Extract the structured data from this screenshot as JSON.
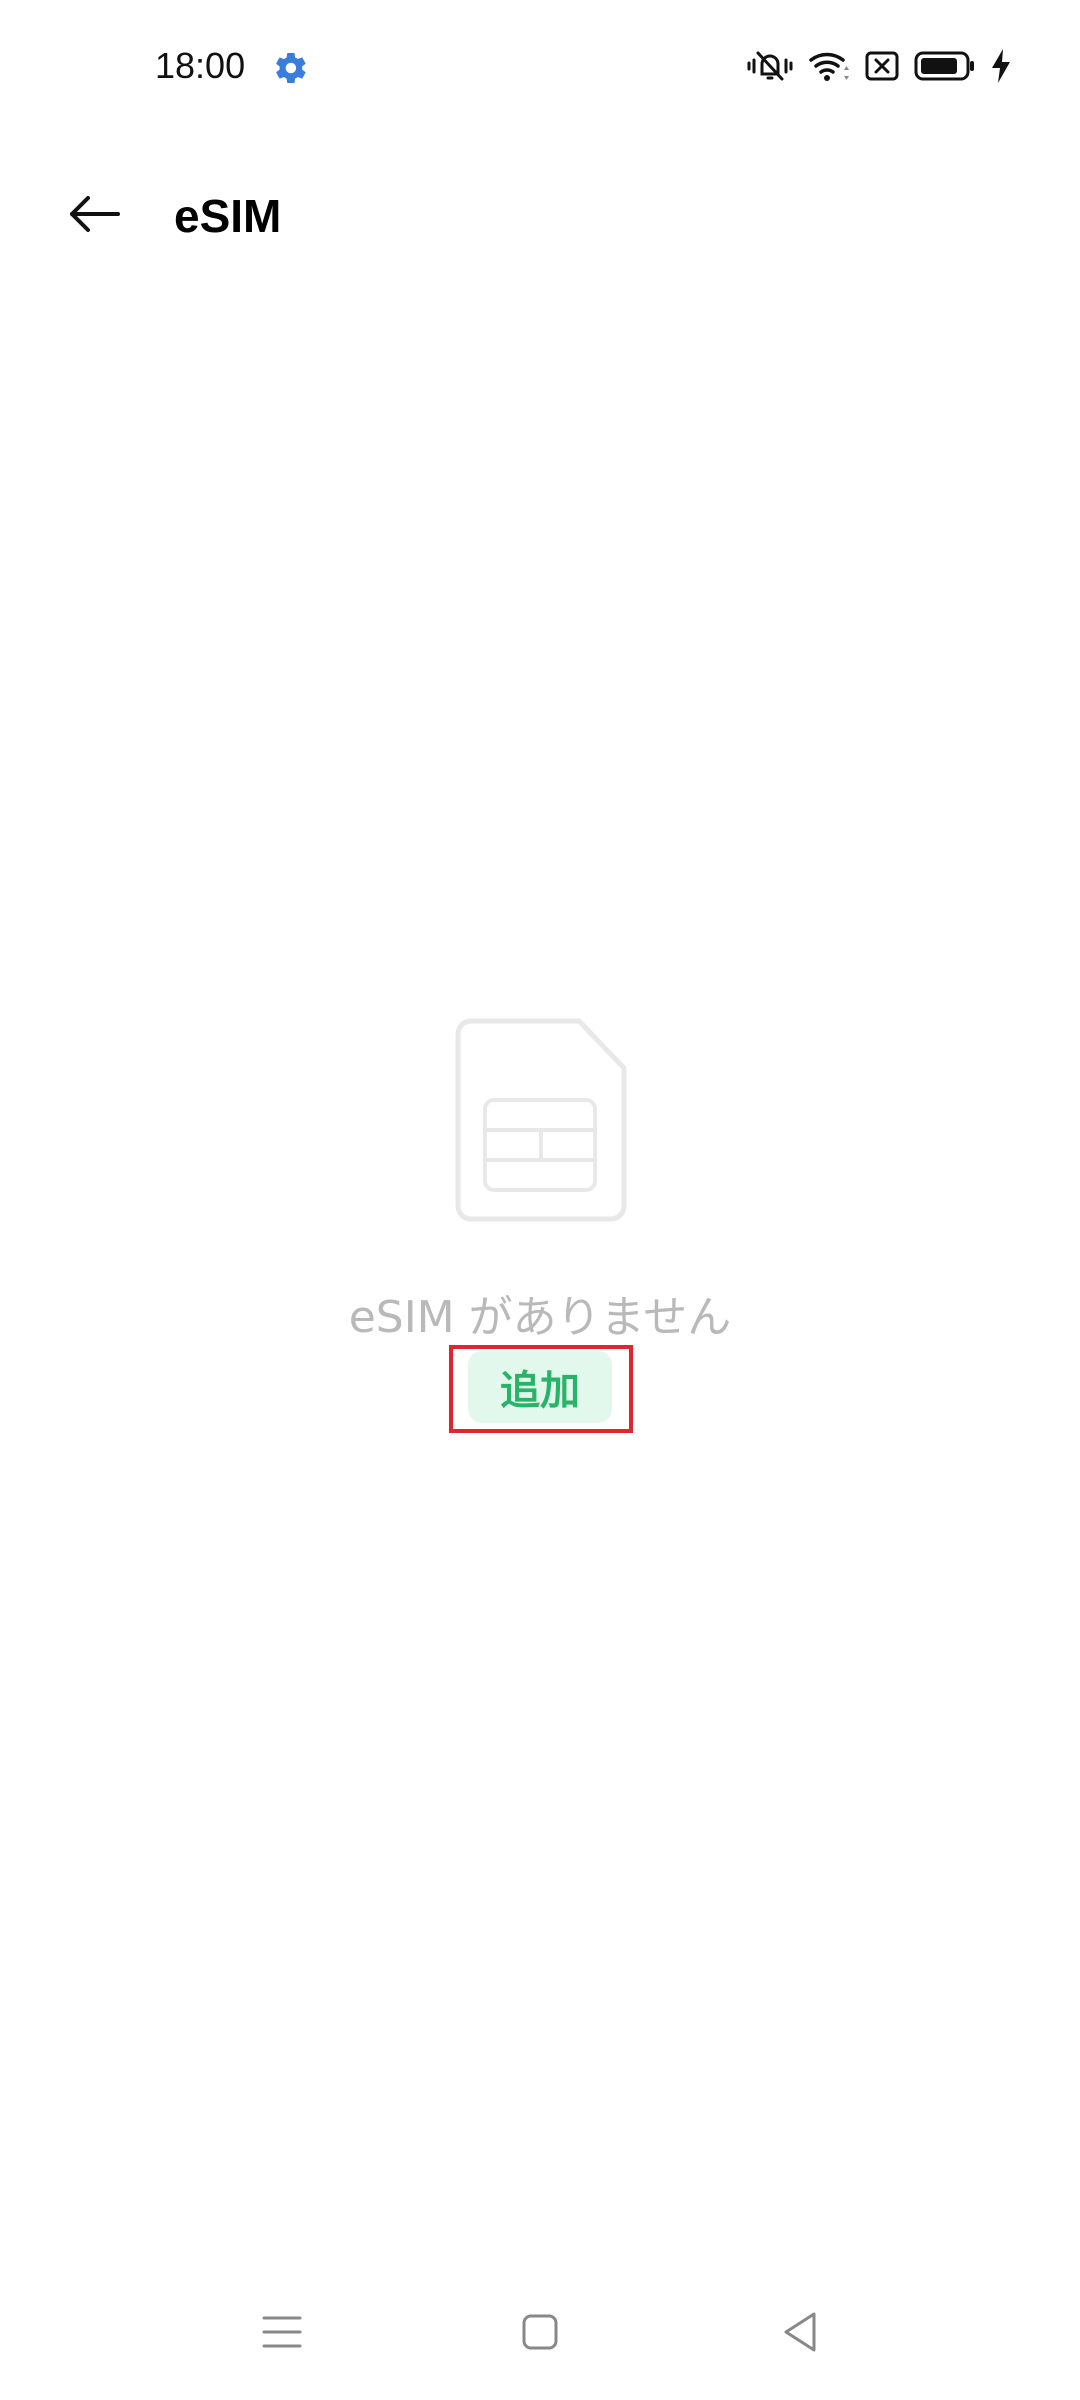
{
  "status_bar": {
    "time": "18:00",
    "left_icons": [
      "gear-icon"
    ],
    "right_icons": [
      "vibrate-icon",
      "wifi-icon",
      "no-sim-icon",
      "battery-icon",
      "charging-icon"
    ]
  },
  "header": {
    "back_icon": "arrow-left-icon",
    "title": "eSIM"
  },
  "empty_state": {
    "icon": "sim-card-icon",
    "message": "eSIM がありません",
    "add_button_label": "追加"
  },
  "nav_bar": {
    "items": [
      "menu-icon",
      "home-icon",
      "back-triangle-icon"
    ]
  },
  "colors": {
    "accent_green": "#28b468",
    "button_bg": "#e3f8ed",
    "muted_text": "#b9b9b9",
    "highlight_red": "#e02530",
    "settings_blue": "#3b7ddd"
  }
}
